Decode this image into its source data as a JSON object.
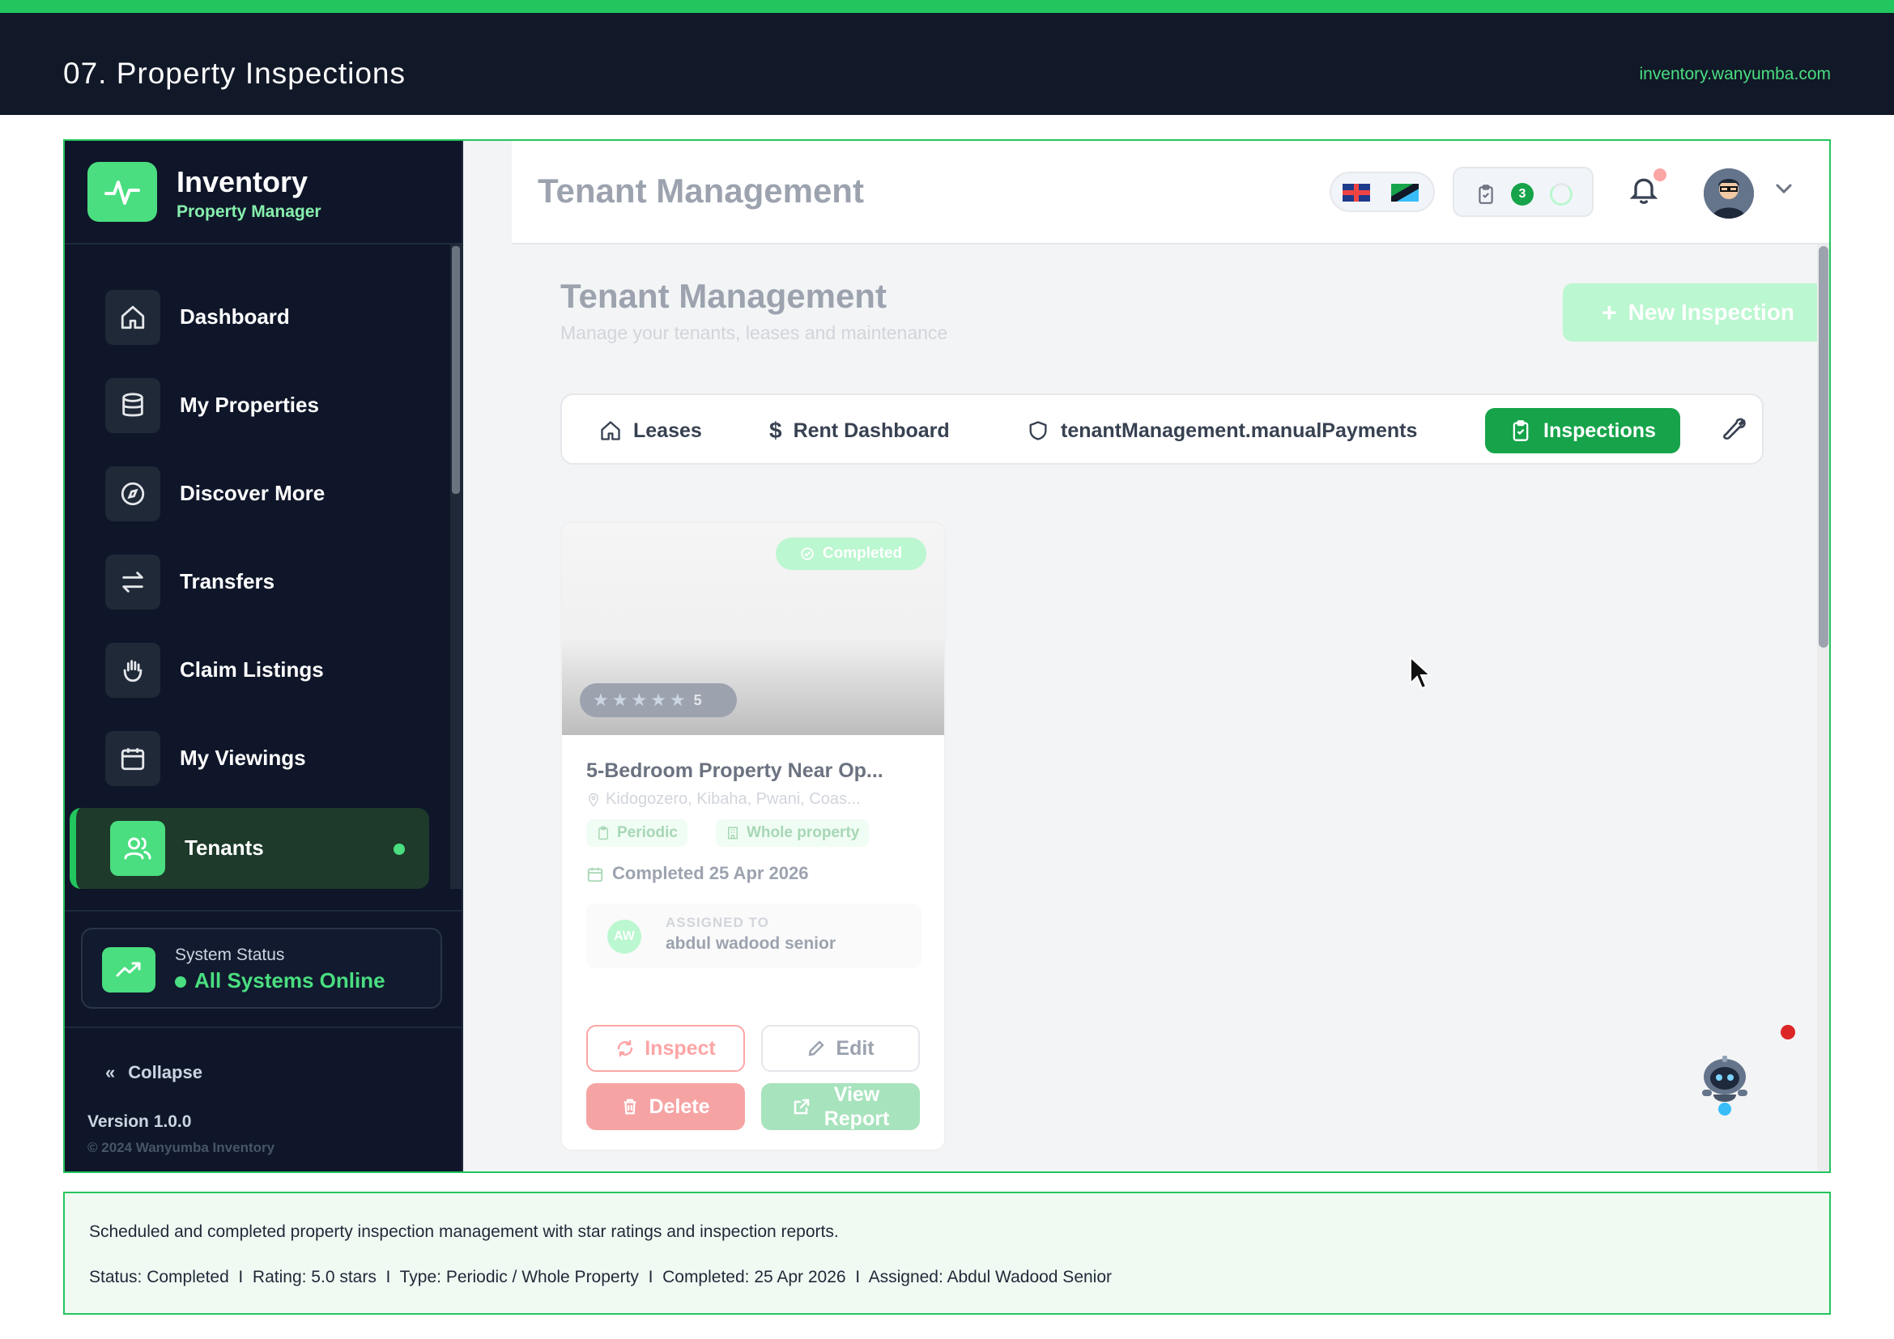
{
  "colors": {
    "accent": "#22c55e",
    "header_bg": "#111827",
    "sidebar_bg": "#0f1629",
    "danger": "#dc2626"
  },
  "page": {
    "title": "07. Property Inspections",
    "url": "inventory.wanyumba.com"
  },
  "sidebar": {
    "brand_name": "Inventory",
    "brand_sub": "Property Manager",
    "items": [
      {
        "label": "Dashboard",
        "icon": "home-icon"
      },
      {
        "label": "My Properties",
        "icon": "database-icon"
      },
      {
        "label": "Discover More",
        "icon": "compass-icon"
      },
      {
        "label": "Transfers",
        "icon": "transfer-arrows-icon"
      },
      {
        "label": "Claim Listings",
        "icon": "hand-icon"
      },
      {
        "label": "My Viewings",
        "icon": "calendar-icon"
      },
      {
        "label": "Tenants",
        "icon": "users-icon",
        "active": true
      }
    ],
    "status_label": "System Status",
    "status_value": "All Systems Online",
    "collapse_label": "Collapse",
    "version": "Version 1.0.0",
    "copyright": "© 2024 Wanyumba Inventory"
  },
  "appbar": {
    "title": "Tenant Management",
    "task_count": "3"
  },
  "content": {
    "title": "Tenant Management",
    "subtitle": "Manage your tenants, leases and maintenance",
    "new_button": "New Inspection",
    "tabs": [
      {
        "label": "Leases",
        "icon": "home-icon"
      },
      {
        "label": "Rent Dashboard",
        "icon": "dollar-icon"
      },
      {
        "label": "tenantManagement.manualPayments",
        "icon": "shield-icon"
      },
      {
        "label": "Inspections",
        "icon": "clipboard-icon",
        "active": true
      }
    ]
  },
  "card": {
    "status": "Completed",
    "rating": "5",
    "rating_value": 5,
    "title": "5-Bedroom Property Near Op...",
    "location": "Kidogozero, Kibaha, Pwani, Coas...",
    "tag_type": "Periodic",
    "tag_scope": "Whole property",
    "date": "Completed 25 Apr 2026",
    "assigned_label": "ASSIGNED TO",
    "assigned_initials": "AW",
    "assigned_name": "abdul wadood senior",
    "btn_inspect": "Inspect",
    "btn_edit": "Edit",
    "btn_delete": "Delete",
    "btn_view_line1": "View",
    "btn_view_line2": "Report"
  },
  "note": {
    "line1": "Scheduled and completed property inspection management with star ratings and inspection reports.",
    "line2": "Status: Completed  I  Rating: 5.0 stars  I  Type: Periodic / Whole Property  I  Completed: 25 Apr 2026  I  Assigned: Abdul Wadood Senior"
  }
}
